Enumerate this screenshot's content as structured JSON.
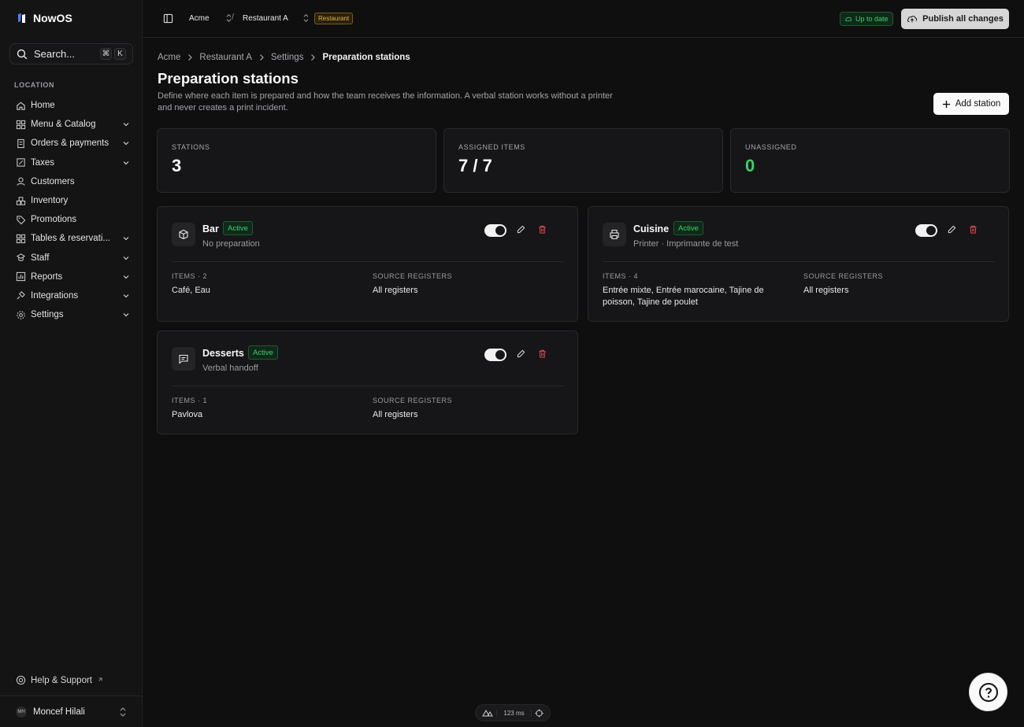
{
  "app": {
    "name": "NowOS"
  },
  "search": {
    "label": "Search...",
    "kbd1": "⌘",
    "kbd2": "K"
  },
  "sidebar": {
    "section_label": "LOCATION",
    "items": [
      {
        "label": "Home",
        "icon": "home-icon",
        "expandable": false
      },
      {
        "label": "Menu & Catalog",
        "icon": "grid-icon",
        "expandable": true
      },
      {
        "label": "Orders & payments",
        "icon": "receipt-icon",
        "expandable": true
      },
      {
        "label": "Taxes",
        "icon": "tax-icon",
        "expandable": true
      },
      {
        "label": "Customers",
        "icon": "user-icon",
        "expandable": false
      },
      {
        "label": "Inventory",
        "icon": "boxes-icon",
        "expandable": false
      },
      {
        "label": "Promotions",
        "icon": "tag-icon",
        "expandable": false
      },
      {
        "label": "Tables & reservati...",
        "icon": "tables-icon",
        "expandable": true
      },
      {
        "label": "Staff",
        "icon": "staff-icon",
        "expandable": true
      },
      {
        "label": "Reports",
        "icon": "chart-icon",
        "expandable": true
      },
      {
        "label": "Integrations",
        "icon": "plug-icon",
        "expandable": true
      },
      {
        "label": "Settings",
        "icon": "gear-icon",
        "expandable": true
      }
    ],
    "help_label": "Help & Support",
    "user": {
      "initials": "MH",
      "name": "Moncef Hilali"
    }
  },
  "topbar": {
    "org": "Acme",
    "separator": "/",
    "location": "Restaurant A",
    "location_tag": "Restaurant",
    "status": "Up to date",
    "publish_label": "Publish all changes"
  },
  "breadcrumb": [
    "Acme",
    "Restaurant A",
    "Settings",
    "Preparation stations"
  ],
  "page": {
    "title": "Preparation stations",
    "description": "Define where each item is prepared and how the team receives the information. A verbal station works without a printer and never creates a print incident.",
    "add_label": "Add station"
  },
  "stats": [
    {
      "label": "STATIONS",
      "value": "3"
    },
    {
      "label": "ASSIGNED ITEMS",
      "value": "7 / 7"
    },
    {
      "label": "UNASSIGNED",
      "value": "0"
    }
  ],
  "stations": [
    {
      "name": "Bar",
      "status": "Active",
      "mode": "No preparation",
      "enabled": true,
      "items_label": "ITEMS · 2",
      "items": "Café, Eau",
      "registers_label": "SOURCE REGISTERS",
      "registers": "All registers"
    },
    {
      "name": "Cuisine",
      "status": "Active",
      "mode": "Printer · Imprimante de test",
      "enabled": true,
      "items_label": "ITEMS · 4",
      "items": "Entrée mixte, Entrée marocaine, Tajine de poisson, Tajine de poulet",
      "registers_label": "SOURCE REGISTERS",
      "registers": "All registers"
    },
    {
      "name": "Desserts",
      "status": "Active",
      "mode": "Verbal handoff",
      "enabled": true,
      "items_label": "ITEMS · 1",
      "items": "Pavlova",
      "registers_label": "SOURCE REGISTERS",
      "registers": "All registers"
    }
  ],
  "devtools": {
    "latency": "123 ms"
  },
  "colors": {
    "accent_green": "#38d16b",
    "danger": "#e5484d",
    "warning": "#e0b24a"
  }
}
